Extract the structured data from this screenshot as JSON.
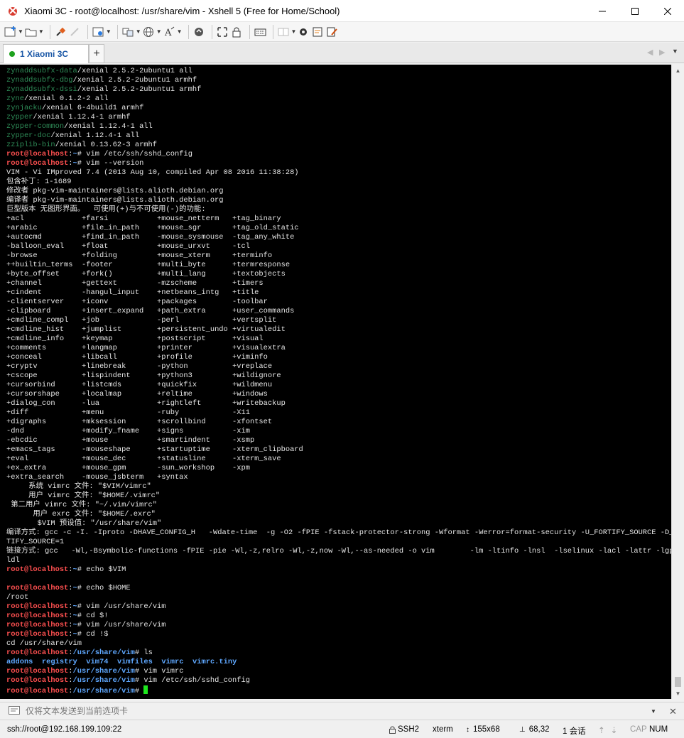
{
  "window": {
    "title": "Xiaomi 3C - root@localhost: /usr/share/vim - Xshell 5 (Free for Home/School)"
  },
  "tabs": [
    {
      "label": "1 Xiaomi 3C",
      "status": "connected"
    }
  ],
  "colors": {
    "prompt_user": "#ff5050",
    "prompt_path": "#5fa8ff",
    "package_name": "#2e8b57",
    "cursor": "#1ee81e",
    "tab_status": "#1ea21e"
  },
  "terminal": {
    "prompt_user": "root@localhost",
    "cursor_visible": true,
    "lines": [
      {
        "t": "pkg",
        "name": "zynaddsubfx-data",
        "rest": "/xenial 2.5.2-2ubuntu1 all"
      },
      {
        "t": "pkg",
        "name": "zynaddsubfx-dbg",
        "rest": "/xenial 2.5.2-2ubuntu1 armhf"
      },
      {
        "t": "pkg",
        "name": "zynaddsubfx-dssi",
        "rest": "/xenial 2.5.2-2ubuntu1 armhf"
      },
      {
        "t": "pkg",
        "name": "zyne",
        "rest": "/xenial 0.1.2-2 all"
      },
      {
        "t": "pkg",
        "name": "zynjacku",
        "rest": "/xenial 6-4build1 armhf"
      },
      {
        "t": "pkg",
        "name": "zypper",
        "rest": "/xenial 1.12.4-1 armhf"
      },
      {
        "t": "pkg",
        "name": "zypper-common",
        "rest": "/xenial 1.12.4-1 all"
      },
      {
        "t": "pkg",
        "name": "zypper-doc",
        "rest": "/xenial 1.12.4-1 all"
      },
      {
        "t": "pkg",
        "name": "zziplib-bin",
        "rest": "/xenial 0.13.62-3 armhf"
      },
      {
        "t": "prompt",
        "path": "~",
        "cmd": " vim /etc/ssh/sshd_config"
      },
      {
        "t": "prompt",
        "path": "~",
        "cmd": " vim --version"
      },
      {
        "t": "text",
        "text": "VIM - Vi IMproved 7.4 (2013 Aug 10, compiled Apr 08 2016 11:38:28)"
      },
      {
        "t": "text",
        "text": "包含补丁: 1-1689"
      },
      {
        "t": "text",
        "text": "修改者 pkg-vim-maintainers@lists.alioth.debian.org"
      },
      {
        "t": "text",
        "text": "编译者 pkg-vim-maintainers@lists.alioth.debian.org"
      },
      {
        "t": "text",
        "text": "巨型版本 无图形界面。  可使用(+)与不可使用(-)的功能:"
      },
      {
        "t": "text",
        "text": "+acl             +farsi           +mouse_netterm   +tag_binary"
      },
      {
        "t": "text",
        "text": "+arabic          +file_in_path    +mouse_sgr       +tag_old_static"
      },
      {
        "t": "text",
        "text": "+autocmd         +find_in_path    -mouse_sysmouse  -tag_any_white"
      },
      {
        "t": "text",
        "text": "-balloon_eval    +float           +mouse_urxvt     -tcl"
      },
      {
        "t": "text",
        "text": "-browse          +folding         +mouse_xterm     +terminfo"
      },
      {
        "t": "text",
        "text": "++builtin_terms  -footer          +multi_byte      +termresponse"
      },
      {
        "t": "text",
        "text": "+byte_offset     +fork()          +multi_lang      +textobjects"
      },
      {
        "t": "text",
        "text": "+channel         +gettext         -mzscheme        +timers"
      },
      {
        "t": "text",
        "text": "+cindent         -hangul_input    +netbeans_intg   +title"
      },
      {
        "t": "text",
        "text": "-clientserver    +iconv           +packages        -toolbar"
      },
      {
        "t": "text",
        "text": "-clipboard       +insert_expand   +path_extra      +user_commands"
      },
      {
        "t": "text",
        "text": "+cmdline_compl   +job             -perl            +vertsplit"
      },
      {
        "t": "text",
        "text": "+cmdline_hist    +jumplist        +persistent_undo +virtualedit"
      },
      {
        "t": "text",
        "text": "+cmdline_info    +keymap          +postscript      +visual"
      },
      {
        "t": "text",
        "text": "+comments        +langmap         +printer         +visualextra"
      },
      {
        "t": "text",
        "text": "+conceal         +libcall         +profile         +viminfo"
      },
      {
        "t": "text",
        "text": "+cryptv          +linebreak       -python          +vreplace"
      },
      {
        "t": "text",
        "text": "+cscope          +lispindent      +python3         +wildignore"
      },
      {
        "t": "text",
        "text": "+cursorbind      +listcmds        +quickfix        +wildmenu"
      },
      {
        "t": "text",
        "text": "+cursorshape     +localmap        +reltime         +windows"
      },
      {
        "t": "text",
        "text": "+dialog_con      -lua             +rightleft       +writebackup"
      },
      {
        "t": "text",
        "text": "+diff            +menu            -ruby            -X11"
      },
      {
        "t": "text",
        "text": "+digraphs        +mksession       +scrollbind      -xfontset"
      },
      {
        "t": "text",
        "text": "-dnd             +modify_fname    +signs           -xim"
      },
      {
        "t": "text",
        "text": "-ebcdic          +mouse           +smartindent     -xsmp"
      },
      {
        "t": "text",
        "text": "+emacs_tags      -mouseshape      +startuptime     -xterm_clipboard"
      },
      {
        "t": "text",
        "text": "+eval            +mouse_dec       +statusline      -xterm_save"
      },
      {
        "t": "text",
        "text": "+ex_extra        +mouse_gpm       -sun_workshop    -xpm"
      },
      {
        "t": "text",
        "text": "+extra_search    -mouse_jsbterm   +syntax"
      },
      {
        "t": "text",
        "text": "     系统 vimrc 文件: \"$VIM/vimrc\""
      },
      {
        "t": "text",
        "text": "     用户 vimrc 文件: \"$HOME/.vimrc\""
      },
      {
        "t": "text",
        "text": " 第二用户 vimrc 文件: \"~/.vim/vimrc\""
      },
      {
        "t": "text",
        "text": "      用户 exrc 文件: \"$HOME/.exrc\""
      },
      {
        "t": "text",
        "text": "       $VIM 预设值: \"/usr/share/vim\""
      },
      {
        "t": "text",
        "text": "编译方式: gcc -c -I. -Iproto -DHAVE_CONFIG_H   -Wdate-time  -g -O2 -fPIE -fstack-protector-strong -Wformat -Werror=format-security -U_FORTIFY_SOURCE -D_FOR"
      },
      {
        "t": "text",
        "text": "TIFY_SOURCE=1"
      },
      {
        "t": "text",
        "text": "链接方式: gcc   -Wl,-Bsymbolic-functions -fPIE -pie -Wl,-z,relro -Wl,-z,now -Wl,--as-needed -o vim        -lm -ltinfo -lnsl  -lselinux -lacl -lattr -lgpm -"
      },
      {
        "t": "text",
        "text": "ldl"
      },
      {
        "t": "prompt",
        "path": "~",
        "cmd": " echo $VIM"
      },
      {
        "t": "text",
        "text": ""
      },
      {
        "t": "prompt",
        "path": "~",
        "cmd": " echo $HOME"
      },
      {
        "t": "text",
        "text": "/root"
      },
      {
        "t": "prompt",
        "path": "~",
        "cmd": " vim /usr/share/vim"
      },
      {
        "t": "prompt",
        "path": "~",
        "cmd": " cd $!"
      },
      {
        "t": "prompt",
        "path": "~",
        "cmd": " vim /usr/share/vim"
      },
      {
        "t": "prompt",
        "path": "~",
        "cmd": " cd !$"
      },
      {
        "t": "text",
        "text": "cd /usr/share/vim"
      },
      {
        "t": "prompt",
        "path": "/usr/share/vim",
        "cmd": " ls"
      },
      {
        "t": "ls",
        "items": [
          "addons",
          "registry",
          "vim74",
          "vimfiles",
          "vimrc",
          "vimrc.tiny"
        ]
      },
      {
        "t": "prompt",
        "path": "/usr/share/vim",
        "cmd": " vim vimrc"
      },
      {
        "t": "prompt",
        "path": "/usr/share/vim",
        "cmd": " vim /etc/ssh/sshd_config"
      },
      {
        "t": "prompt",
        "path": "/usr/share/vim",
        "cmd": " ",
        "cursor": true
      }
    ]
  },
  "compose": {
    "placeholder": "仅将文本发送到当前选项卡"
  },
  "statusbar": {
    "connection": "ssh://root@192.168.199.109:22",
    "protocol": "SSH2",
    "terminal_type": "xterm",
    "size": "155x68",
    "cursor_pos": "68,32",
    "sessions": "1 会话",
    "caps": "CAP",
    "num": "NUM"
  }
}
